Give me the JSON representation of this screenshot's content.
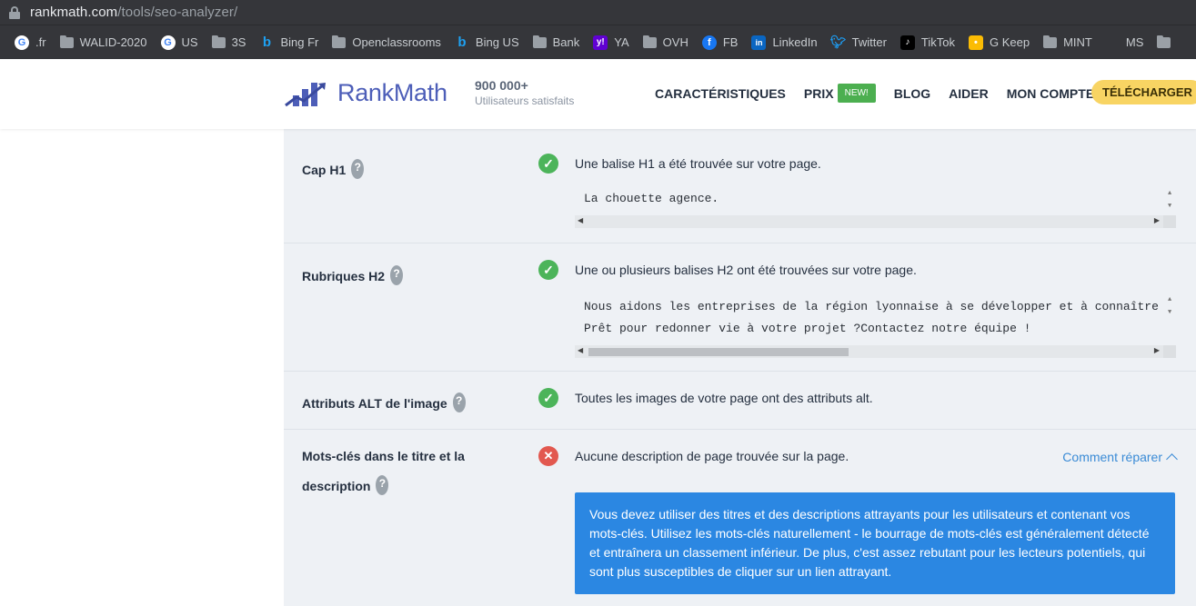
{
  "browser": {
    "url_host": "rankmath.com",
    "url_path": "/tools/seo-analyzer/"
  },
  "bookmarks": [
    {
      "label": ".fr",
      "icon": "google-icon"
    },
    {
      "label": "WALID-2020",
      "icon": "folder-icon"
    },
    {
      "label": "US",
      "icon": "google-icon"
    },
    {
      "label": "3S",
      "icon": "folder-icon"
    },
    {
      "label": "Bing Fr",
      "icon": "bing-icon"
    },
    {
      "label": "Openclassrooms",
      "icon": "folder-icon"
    },
    {
      "label": "Bing US",
      "icon": "bing-icon"
    },
    {
      "label": "Bank",
      "icon": "folder-icon"
    },
    {
      "label": "YA",
      "icon": "yahoo-icon"
    },
    {
      "label": "OVH",
      "icon": "folder-icon"
    },
    {
      "label": "FB",
      "icon": "facebook-icon"
    },
    {
      "label": "LinkedIn",
      "icon": "linkedin-icon"
    },
    {
      "label": "Twitter",
      "icon": "twitter-icon"
    },
    {
      "label": "TikTok",
      "icon": "tiktok-icon"
    },
    {
      "label": "G Keep",
      "icon": "google-keep-icon"
    },
    {
      "label": "MINT",
      "icon": "folder-icon"
    },
    {
      "label": "MS",
      "icon": "microsoft-icon"
    }
  ],
  "header": {
    "brand": "RankMath",
    "users_count": "900 000+",
    "users_label": "Utilisateurs satisfaits",
    "nav": {
      "features": "CARACTÉRISTIQUES",
      "pricing": "PRIX",
      "pricing_badge": "NEW!",
      "blog": "BLOG",
      "help": "AIDER",
      "account": "MON COMPTE",
      "download": "TÉLÉCHARGER"
    },
    "colors": {
      "accent": "#4d5eb8",
      "download_bg": "#f8d463",
      "badge_bg": "#4caf50"
    }
  },
  "checks": {
    "h1": {
      "title": "Cap H1",
      "status": "pass",
      "message": "Une balise H1 a été trouvée sur votre page.",
      "code": [
        "La chouette agence."
      ]
    },
    "h2": {
      "title": "Rubriques H2",
      "status": "pass",
      "message": "Une ou plusieurs balises H2 ont été trouvées sur votre page.",
      "code": [
        "Nous aidons les entreprises de la région lyonnaise à se développer et à connaître",
        "Prêt pour redonner vie à votre projet ?Contactez notre équipe !"
      ]
    },
    "alt": {
      "title": "Attributs ALT de l'image",
      "status": "pass",
      "message": "Toutes les images de votre page ont des attributs alt."
    },
    "keywords": {
      "title_line1": "Mots-clés dans le titre et la",
      "title_line2": "description",
      "status": "fail",
      "message": "Aucune description de page trouvée sur la page.",
      "fix_label": "Comment réparer",
      "info": "Vous devez utiliser des titres et des descriptions attrayants pour les utilisateurs et contenant vos mots-clés. Utilisez les mots-clés naturellement - le bourrage de mots-clés est généralement détecté et entraînera un classement inférieur. De plus, c'est assez rebutant pour les lecteurs potentiels, qui sont plus susceptibles de cliquer sur un lien attrayant."
    }
  },
  "help_glyph": "?",
  "status_colors": {
    "pass": "#4cb45a",
    "fail": "#e2584f",
    "info_bg": "#2b87e2"
  }
}
